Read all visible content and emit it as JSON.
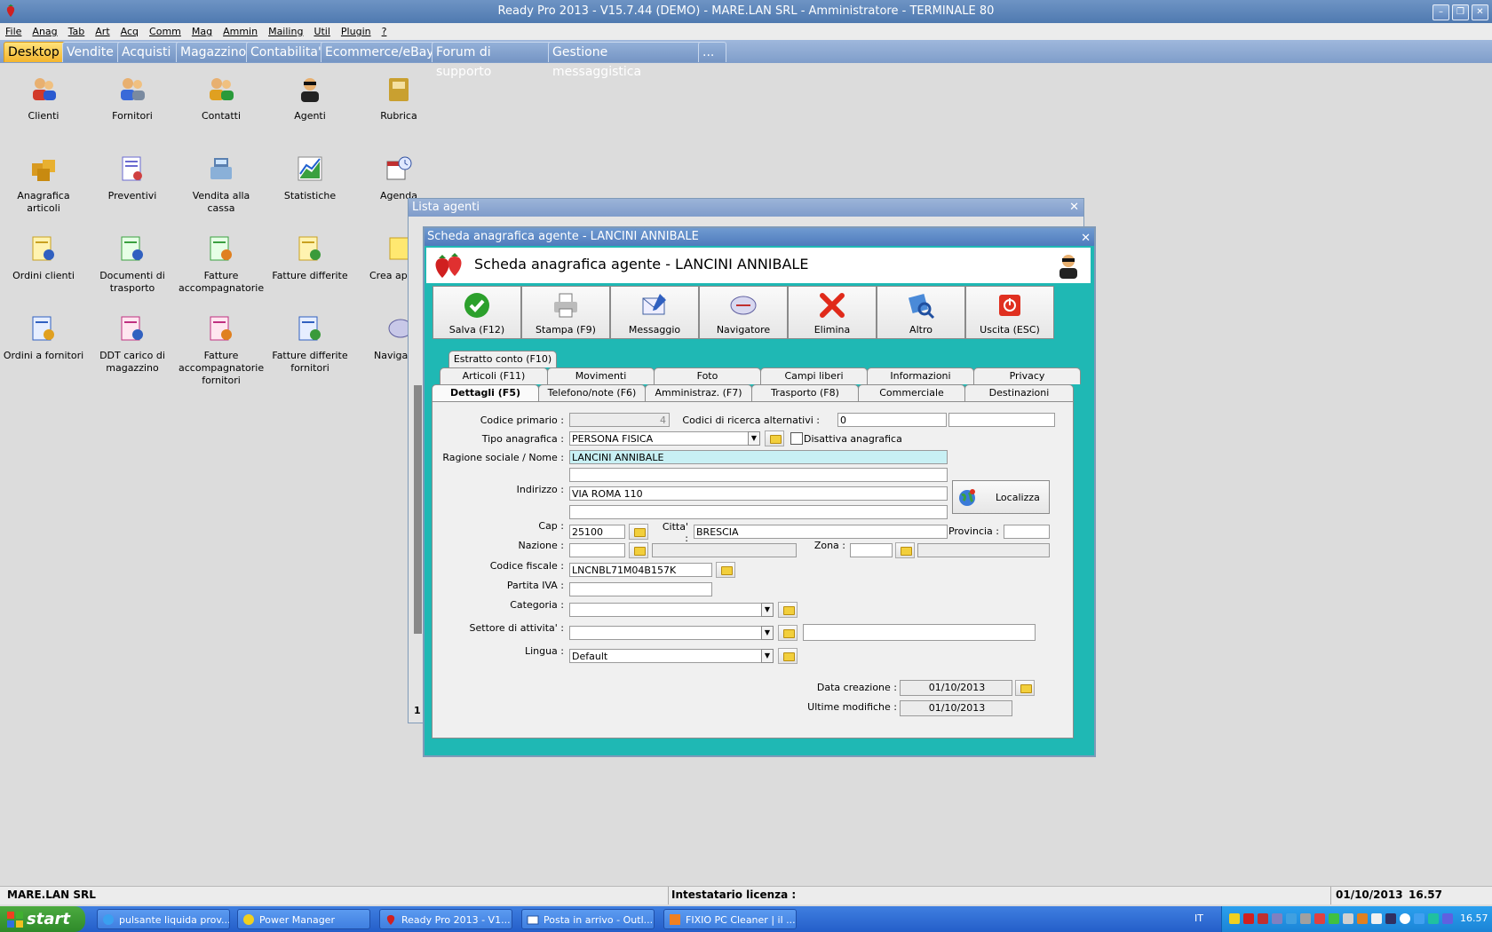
{
  "window": {
    "title": "Ready Pro 2013 - V15.7.44 (DEMO) - MARE.LAN SRL - Amministratore - TERMINALE 80"
  },
  "menu": [
    "File",
    "Anag",
    "Tab",
    "Art",
    "Acq",
    "Comm",
    "Mag",
    "Ammin",
    "Mailing",
    "Util",
    "Plugin",
    "?"
  ],
  "ribbon_tabs": [
    "Desktop",
    "Vendite",
    "Acquisti",
    "Magazzino",
    "Contabilita'",
    "Ecommerce/eBay",
    "Forum di supporto",
    "Gestione messaggistica",
    "..."
  ],
  "desktop_icons": [
    {
      "label": "Clienti",
      "icon": "clients-icon"
    },
    {
      "label": "Fornitori",
      "icon": "suppliers-icon"
    },
    {
      "label": "Contatti",
      "icon": "contacts-icon"
    },
    {
      "label": "Agenti",
      "icon": "agent-icon"
    },
    {
      "label": "Rubrica",
      "icon": "address-book-icon"
    },
    {
      "label": "Anagrafica articoli",
      "icon": "boxes-icon"
    },
    {
      "label": "Preventivi",
      "icon": "quote-icon"
    },
    {
      "label": "Vendita alla cassa",
      "icon": "cash-register-icon"
    },
    {
      "label": "Statistiche",
      "icon": "chart-icon"
    },
    {
      "label": "Agenda",
      "icon": "calendar-icon"
    },
    {
      "label": "Ordini clienti",
      "icon": "document-icon"
    },
    {
      "label": "Documenti di trasporto",
      "icon": "document-icon"
    },
    {
      "label": "Fatture accompagnatorie",
      "icon": "document-icon"
    },
    {
      "label": "Fatture differite",
      "icon": "document-icon"
    },
    {
      "label": "Crea app",
      "icon": "note-icon"
    },
    {
      "label": "Ordini a fornitori",
      "icon": "document-icon"
    },
    {
      "label": "DDT carico di magazzino",
      "icon": "document-icon"
    },
    {
      "label": "Fatture accompagnatorie fornitori",
      "icon": "document-icon"
    },
    {
      "label": "Fatture differite fornitori",
      "icon": "document-icon"
    },
    {
      "label": "Navigat",
      "icon": "navigator-icon"
    }
  ],
  "lista": {
    "title": "Lista agenti",
    "page": "1"
  },
  "dialog": {
    "title": "Scheda anagrafica agente - LANCINI ANNIBALE",
    "header_title": "Scheda anagrafica agente - LANCINI ANNIBALE",
    "toolbar": [
      {
        "label": "Salva (F12)",
        "icon": "check-icon"
      },
      {
        "label": "Stampa (F9)",
        "icon": "printer-icon"
      },
      {
        "label": "Messaggio",
        "icon": "message-icon"
      },
      {
        "label": "Navigatore",
        "icon": "navigator-icon"
      },
      {
        "label": "Elimina",
        "icon": "delete-icon"
      },
      {
        "label": "Altro",
        "icon": "more-icon"
      },
      {
        "label": "Uscita (ESC)",
        "icon": "exit-icon"
      }
    ],
    "tabs_row1": [
      "Estratto conto (F10)"
    ],
    "tabs_row2": [
      "Articoli (F11)",
      "Movimenti",
      "Foto",
      "Campi liberi",
      "Informazioni",
      "Privacy"
    ],
    "tabs_row3": [
      "Dettagli (F5)",
      "Telefono/note (F6)",
      "Amministraz. (F7)",
      "Trasporto (F8)",
      "Commerciale",
      "Destinazioni"
    ],
    "form": {
      "codice_primario_label": "Codice primario :",
      "codice_primario": "4",
      "codici_alt_label": "Codici di ricerca alternativi :",
      "codici_alt": "0",
      "tipo_label": "Tipo anagrafica :",
      "tipo": "PERSONA FISICA",
      "disattiva_label": "Disattiva anagrafica",
      "ragione_label": "Ragione sociale / Nome :",
      "ragione": "LANCINI ANNIBALE",
      "indirizzo_label": "Indirizzo :",
      "indirizzo": "VIA ROMA 110",
      "localizza": "Localizza",
      "cap_label": "Cap :",
      "cap": "25100",
      "citta_label": "Citta' :",
      "citta": "BRESCIA",
      "provincia_label": "Provincia :",
      "nazione_label": "Nazione :",
      "zona_label": "Zona :",
      "cf_label": "Codice fiscale :",
      "cf": "LNCNBL71M04B157K",
      "piva_label": "Partita IVA :",
      "categoria_label": "Categoria :",
      "settore_label": "Settore di attivita' :",
      "lingua_label": "Lingua :",
      "lingua": "Default",
      "data_creazione_label": "Data creazione :",
      "data_creazione": "01/10/2013",
      "ultime_modifiche_label": "Ultime modifiche :",
      "ultime_modifiche": "01/10/2013"
    }
  },
  "statusbar": {
    "company": "MARE.LAN SRL",
    "licensee_label": "Intestatario licenza :",
    "date": "01/10/2013",
    "time": "16.57"
  },
  "taskbar": {
    "start": "start",
    "tasks": [
      "pulsante liquida prov...",
      "Power Manager",
      "Ready Pro 2013 - V1...",
      "Posta in arrivo - Outl...",
      "FIXIO PC Cleaner | il ..."
    ],
    "lang": "IT",
    "clock": "16.57"
  }
}
